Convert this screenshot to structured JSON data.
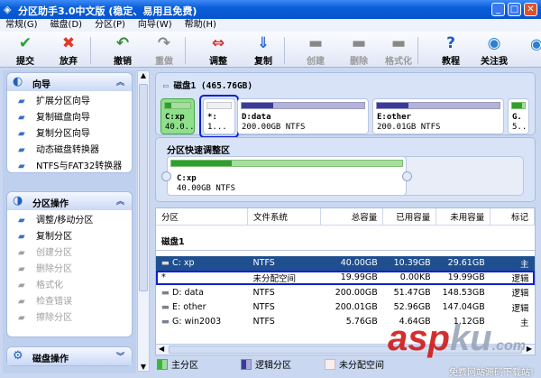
{
  "window": {
    "title": "分区助手3.0中文版 (稳定、易用且免费)",
    "minimize": "_",
    "maximize": "□",
    "close": "✕"
  },
  "menu": [
    "常规(G)",
    "磁盘(D)",
    "分区(P)",
    "向导(W)",
    "帮助(H)"
  ],
  "toolbar": [
    {
      "label": "提交",
      "icon": "check-icon",
      "glyph": "✔",
      "color": "#2aa12a",
      "enabled": true
    },
    {
      "label": "放弃",
      "icon": "x-icon",
      "glyph": "✖",
      "color": "#e03a2a",
      "enabled": true
    },
    {
      "label": "撤销",
      "icon": "undo-icon",
      "glyph": "↶",
      "color": "#3a8a3a",
      "enabled": true
    },
    {
      "label": "重做",
      "icon": "redo-icon",
      "glyph": "↷",
      "color": "#888",
      "enabled": false
    },
    {
      "label": "调整",
      "icon": "resize-icon",
      "glyph": "⇔",
      "color": "#d03030",
      "enabled": true
    },
    {
      "label": "复制",
      "icon": "copy-icon",
      "glyph": "⇓",
      "color": "#2a6ad0",
      "enabled": true
    },
    {
      "label": "创建",
      "icon": "create-icon",
      "glyph": "▬",
      "color": "#888",
      "enabled": false
    },
    {
      "label": "删除",
      "icon": "delete-icon",
      "glyph": "▬",
      "color": "#888",
      "enabled": false
    },
    {
      "label": "格式化",
      "icon": "format-icon",
      "glyph": "▬",
      "color": "#888",
      "enabled": false
    },
    {
      "label": "教程",
      "icon": "help-icon",
      "glyph": "?",
      "color": "#1a5ac8",
      "enabled": true
    },
    {
      "label": "关注我",
      "icon": "globe-icon",
      "glyph": "◉",
      "color": "#2a80d0",
      "enabled": true
    }
  ],
  "sidebar": {
    "wizard": {
      "title": "向导",
      "items": [
        {
          "label": "扩展分区向导",
          "enabled": true
        },
        {
          "label": "复制磁盘向导",
          "enabled": true
        },
        {
          "label": "复制分区向导",
          "enabled": true
        },
        {
          "label": "动态磁盘转换器",
          "enabled": true
        },
        {
          "label": "NTFS与FAT32转换器",
          "enabled": true
        }
      ]
    },
    "partition_ops": {
      "title": "分区操作",
      "items": [
        {
          "label": "调整/移动分区",
          "enabled": true
        },
        {
          "label": "复制分区",
          "enabled": true
        },
        {
          "label": "创建分区",
          "enabled": false
        },
        {
          "label": "删除分区",
          "enabled": false
        },
        {
          "label": "格式化",
          "enabled": false
        },
        {
          "label": "检查错误",
          "enabled": false
        },
        {
          "label": "擦除分区",
          "enabled": false
        }
      ]
    },
    "disk_ops": {
      "title": "磁盘操作"
    }
  },
  "diskmap": {
    "title": "磁盘1 (465.76GB)",
    "partitions": [
      {
        "name": "C:xp",
        "size": "40.0...",
        "type": "primary",
        "used_fraction": 0.26
      },
      {
        "name": "*:",
        "size": "1...",
        "type": "unallocated",
        "used_fraction": 0
      },
      {
        "name": "D:data",
        "size": "200.00GB NTFS",
        "type": "logical",
        "used_fraction": 0.26
      },
      {
        "name": "E:other",
        "size": "200.01GB NTFS",
        "type": "logical",
        "used_fraction": 0.26
      },
      {
        "name": "G.",
        "size": "5..",
        "type": "primary",
        "used_fraction": 0.8
      }
    ]
  },
  "quick_adjust": {
    "title": "分区快速调整区",
    "name": "C:xp",
    "size": "40.00GB NTFS",
    "used_fraction": 0.26
  },
  "table": {
    "headers": [
      "分区",
      "文件系统",
      "总容量",
      "已用容量",
      "未用容量",
      "标记"
    ],
    "disk_label": "磁盘1",
    "rows": [
      [
        "C: xp",
        "NTFS",
        "40.00GB",
        "10.39GB",
        "29.61GB",
        "主"
      ],
      [
        "*",
        "未分配空间",
        "19.99GB",
        "0.00KB",
        "19.99GB",
        "逻辑"
      ],
      [
        "D: data",
        "NTFS",
        "200.00GB",
        "51.47GB",
        "148.53GB",
        "逻辑"
      ],
      [
        "E: other",
        "NTFS",
        "200.01GB",
        "52.96GB",
        "147.04GB",
        "逻辑"
      ],
      [
        "G: win2003",
        "NTFS",
        "5.76GB",
        "4.64GB",
        "1.12GB",
        "主"
      ]
    ],
    "selected_row": 0,
    "highlighted_row": 1
  },
  "legend": [
    "主分区",
    "逻辑分区",
    "未分配空间"
  ],
  "colors": {
    "primary": "#3cb43c",
    "logical": "#3a3a9a",
    "unallocated": "#f2eeee",
    "selection": "#1f4f8f",
    "highlight": "#1020d0"
  },
  "watermark": {
    "logo": "aspku.com",
    "slogan": "免费网站源码下载站!"
  }
}
